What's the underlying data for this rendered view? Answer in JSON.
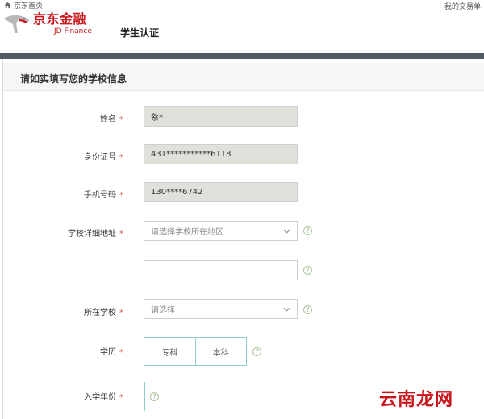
{
  "topbar": {
    "home": "京东首页",
    "orders": "我的交易单"
  },
  "header": {
    "logo_cn": "京东金融",
    "logo_en": "JD Finance",
    "title": "学生认证"
  },
  "section": {
    "title": "请如实填写您的学校信息"
  },
  "form": {
    "name": {
      "label": "姓名",
      "required": "*",
      "value": "蔡*"
    },
    "id_number": {
      "label": "身份证号",
      "required": "*",
      "value": "431***********6118"
    },
    "phone": {
      "label": "手机号码",
      "required": "*",
      "value": "130****6742"
    },
    "school_address": {
      "label": "学校详细地址",
      "required": "*",
      "placeholder": "请选择学校所在地区",
      "detail_value": ""
    },
    "school": {
      "label": "所在学校",
      "required": "*",
      "placeholder": "请选择"
    },
    "education": {
      "label": "学历",
      "required": "*",
      "options": [
        "专科",
        "本科"
      ]
    },
    "enroll_year": {
      "label": "入学年份",
      "required": "*"
    }
  },
  "help_glyph": "?",
  "icons": {
    "home": "home-icon",
    "chevron": "chevron-down-icon",
    "help": "help-icon",
    "logo": "jd-dog-logo"
  },
  "colors": {
    "brand": "#c8161d",
    "readonly_bg": "#e1e1db",
    "accent_border": "#8fd0cc",
    "required": "#d9534f"
  },
  "watermark": "云南龙网"
}
